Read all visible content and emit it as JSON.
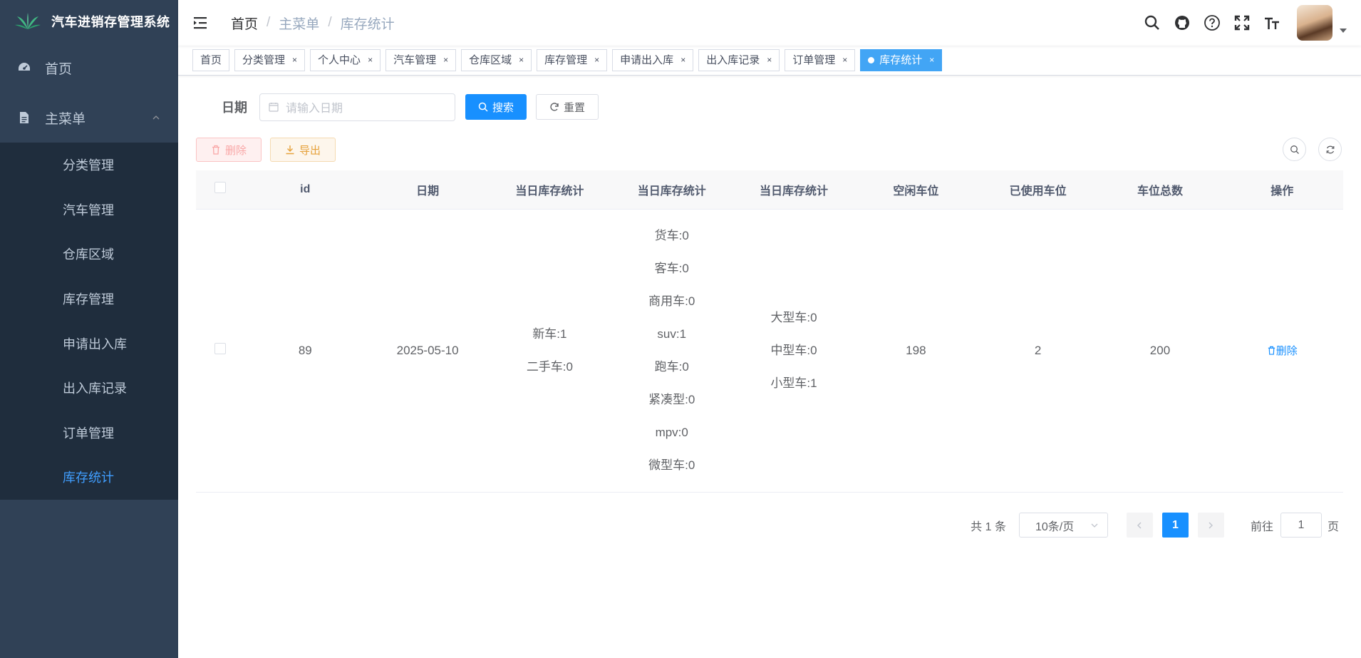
{
  "app": {
    "title": "汽车进销存管理系统"
  },
  "sidebar": {
    "home": "首页",
    "main_menu": "主菜单",
    "sub_items": [
      "分类管理",
      "汽车管理",
      "仓库区域",
      "库存管理",
      "申请出入库",
      "出入库记录",
      "订单管理",
      "库存统计"
    ],
    "active": "库存统计"
  },
  "breadcrumb": [
    "首页",
    "主菜单",
    "库存统计"
  ],
  "tags": [
    "首页",
    "分类管理",
    "个人中心",
    "汽车管理",
    "仓库区域",
    "库存管理",
    "申请出入库",
    "出入库记录",
    "订单管理",
    "库存统计"
  ],
  "tag_close": "×",
  "search": {
    "label": "日期",
    "placeholder": "请输入日期",
    "search_btn": "搜索",
    "reset_btn": "重置"
  },
  "toolbar": {
    "delete": "删除",
    "export": "导出"
  },
  "table": {
    "headers": [
      "id",
      "日期",
      "当日库存统计",
      "当日库存统计",
      "当日库存统计",
      "空闲车位",
      "已使用车位",
      "车位总数",
      "操作"
    ],
    "rows": [
      {
        "id": "89",
        "date": "2025-05-10",
        "age_stats": [
          "新车:1",
          "二手车:0"
        ],
        "type_stats": [
          "货车:0",
          "客车:0",
          "商用车:0",
          "suv:1",
          "跑车:0",
          "紧凑型:0",
          "mpv:0",
          "微型车:0"
        ],
        "size_stats": [
          "大型车:0",
          "中型车:0",
          "小型车:1"
        ],
        "free_spaces": "198",
        "used_spaces": "2",
        "total_spaces": "200",
        "op": "删除"
      }
    ]
  },
  "pagination": {
    "total": "共 1 条",
    "page_size": "10条/页",
    "current": "1",
    "goto_prefix": "前往",
    "goto_value": "1",
    "goto_suffix": "页"
  },
  "colors": {
    "sidebar": "#304156",
    "submenu": "#1f2d3d",
    "primary": "#1890ff",
    "active_tag": "#42a5f5"
  }
}
